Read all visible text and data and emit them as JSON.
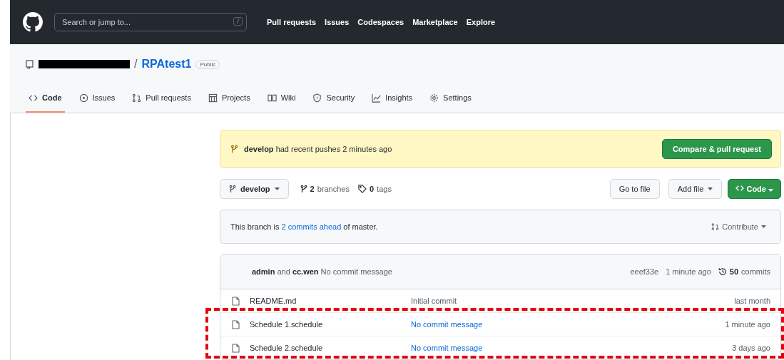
{
  "header": {
    "search": {
      "placeholder": "Search or jump to...",
      "shortcut": "/"
    },
    "nav": [
      "Pull requests",
      "Issues",
      "Codespaces",
      "Marketplace",
      "Explore"
    ]
  },
  "repo": {
    "separator": "/",
    "name": "RPAtest1",
    "visibility": "Public"
  },
  "tabs": [
    {
      "label": "Code",
      "selected": true
    },
    {
      "label": "Issues",
      "selected": false
    },
    {
      "label": "Pull requests",
      "selected": false
    },
    {
      "label": "Projects",
      "selected": false
    },
    {
      "label": "Wiki",
      "selected": false
    },
    {
      "label": "Security",
      "selected": false
    },
    {
      "label": "Insights",
      "selected": false
    },
    {
      "label": "Settings",
      "selected": false
    }
  ],
  "banner": {
    "branch": "develop",
    "text": "had recent pushes 2 minutes ago",
    "button": "Compare & pull request"
  },
  "toolbar": {
    "branch": "develop",
    "branches_count": "2",
    "branches_label": "branches",
    "tags_count": "0",
    "tags_label": "tags",
    "go_to_file": "Go to file",
    "add_file": "Add file",
    "code": "Code"
  },
  "branch_info": {
    "before": "This branch is",
    "link": "2 commits ahead",
    "after": "of master.",
    "contribute": "Contribute"
  },
  "latest_commit": {
    "author": "admin",
    "joiner": "and",
    "coauthor": "cc.wen",
    "message": "No commit message",
    "hash": "eeef33e",
    "time": "1 minute ago",
    "commits_count": "50",
    "commits_label": "commits"
  },
  "files": [
    {
      "name": "README.md",
      "message": "Initial commit",
      "link": false,
      "time": "last month"
    },
    {
      "name": "Schedule 1.schedule",
      "message": "No commit message",
      "link": true,
      "time": "1 minute ago"
    },
    {
      "name": "Schedule 2.schedule",
      "message": "No commit message",
      "link": true,
      "time": "3 days ago"
    }
  ]
}
